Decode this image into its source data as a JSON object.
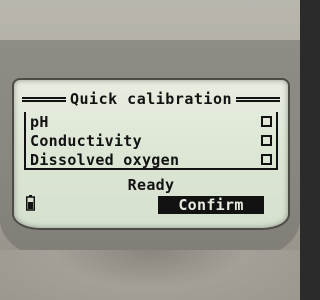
{
  "screen": {
    "title": "Quick calibration",
    "items": [
      {
        "label": "pH",
        "checked": false
      },
      {
        "label": "Conductivity",
        "checked": false
      },
      {
        "label": "Dissolved oxygen",
        "checked": false
      }
    ],
    "status": "Ready",
    "confirm_label": "Confirm",
    "battery_icon": "battery-icon"
  },
  "colors": {
    "lcd_background": "#dde6d5",
    "lcd_ink": "#121212",
    "bezel": "#a9a59c"
  }
}
